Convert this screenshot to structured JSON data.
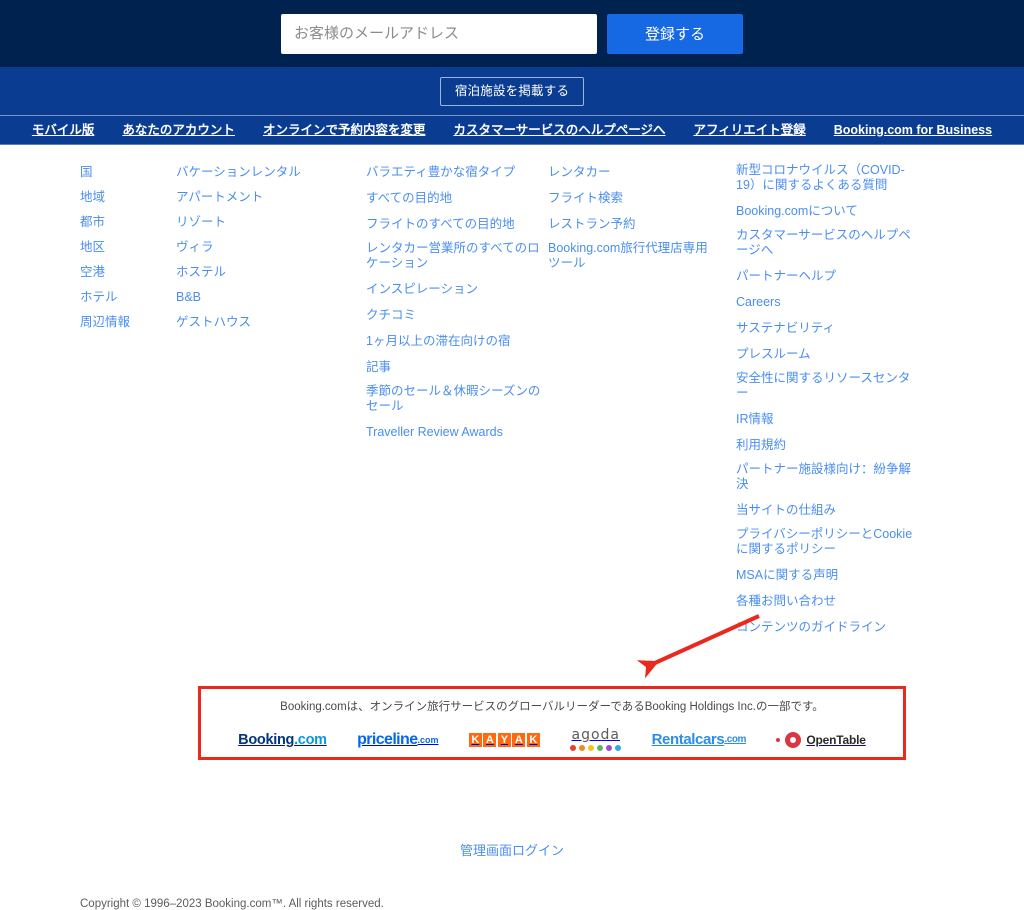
{
  "newsletter": {
    "email_placeholder": "お客様のメールアドレス",
    "email_value": "",
    "subscribe_label": "登録する"
  },
  "list_property": {
    "button_label": "宿泊施設を掲載する"
  },
  "nav_links": [
    {
      "label": "モバイル版"
    },
    {
      "label": "あなたのアカウント"
    },
    {
      "label": "オンラインで予約内容を変更"
    },
    {
      "label": "カスタマーサービスのヘルプページへ"
    },
    {
      "label": "アフィリエイト登録"
    },
    {
      "label": "Booking.com for Business"
    }
  ],
  "columns": [
    {
      "items": [
        {
          "label": "国"
        },
        {
          "label": "地域"
        },
        {
          "label": "都市"
        },
        {
          "label": "地区"
        },
        {
          "label": "空港"
        },
        {
          "label": "ホテル"
        },
        {
          "label": "周辺情報"
        }
      ]
    },
    {
      "items": [
        {
          "label": "バケーションレンタル"
        },
        {
          "label": "アパートメント"
        },
        {
          "label": "リゾート"
        },
        {
          "label": "ヴィラ"
        },
        {
          "label": "ホステル"
        },
        {
          "label": "B&B"
        },
        {
          "label": "ゲストハウス"
        }
      ]
    },
    {
      "items": [
        {
          "label": "バラエティ豊かな宿タイプ"
        },
        {
          "label": "すべての目的地"
        },
        {
          "label": "フライトのすべての目的地"
        },
        {
          "label": "レンタカー営業所のすべてのロケーション"
        },
        {
          "label": "インスピレーション"
        },
        {
          "label": "クチコミ"
        },
        {
          "label": "1ヶ月以上の滞在向けの宿"
        },
        {
          "label": "記事"
        },
        {
          "label": "季節のセール＆休暇シーズンのセール"
        },
        {
          "label": "Traveller Review Awards"
        }
      ]
    },
    {
      "items": [
        {
          "label": "レンタカー"
        },
        {
          "label": "フライト検索"
        },
        {
          "label": "レストラン予約"
        },
        {
          "label": "Booking.com旅行代理店専用ツール"
        }
      ]
    },
    {
      "items": [
        {
          "label": "新型コロナウイルス（COVID-19）に関するよくある質問"
        },
        {
          "label": "Booking.comについて"
        },
        {
          "label": "カスタマーサービスのヘルプページへ"
        },
        {
          "label": "パートナーヘルプ"
        },
        {
          "label": "Careers"
        },
        {
          "label": "サステナビリティ"
        },
        {
          "label": "プレスルーム"
        },
        {
          "label": "安全性に関するリソースセンター"
        },
        {
          "label": "IR情報"
        },
        {
          "label": "利用規約"
        },
        {
          "label": "パートナー施設様向け：紛争解決"
        },
        {
          "label": "当サイトの仕組み"
        },
        {
          "label": "プライバシーポリシーとCookieに関するポリシー"
        },
        {
          "label": "MSAに関する声明"
        },
        {
          "label": "各種お問い合わせ"
        },
        {
          "label": "コンテンツのガイドライン"
        }
      ]
    }
  ],
  "admin_login": {
    "label": "管理画面ログイン"
  },
  "copyright": {
    "text": "Copyright © 1996–2023 Booking.com™. All rights reserved."
  },
  "brands": {
    "description": "Booking.comは、オンライン旅行サービスのグローバルリーダーであるBooking Holdings Inc.の一部です。",
    "logos": [
      {
        "name": "booking",
        "part1": "Booking",
        "part2": ".com"
      },
      {
        "name": "priceline",
        "part1": "priceline",
        "part2": ".com"
      },
      {
        "name": "kayak",
        "letters": [
          "K",
          "A",
          "Y",
          "A",
          "K"
        ]
      },
      {
        "name": "agoda",
        "word": "agoda",
        "dot_colors": [
          "#e8402a",
          "#f08c1c",
          "#f5c518",
          "#5cb85c",
          "#9b4fc8",
          "#2eaadc"
        ]
      },
      {
        "name": "rentalcars",
        "part1": "Rentalcars",
        "part2": ".com"
      },
      {
        "name": "opentable",
        "word": "OpenTable"
      }
    ],
    "highlight_color": "#e8291c"
  },
  "annotation": {
    "arrow_color": "#e8291c"
  },
  "theme": {
    "dark_navy": "#00224f",
    "brand_blue": "#0a3d91",
    "link_blue": "#4a8ef0",
    "button_blue": "#1668e3"
  }
}
